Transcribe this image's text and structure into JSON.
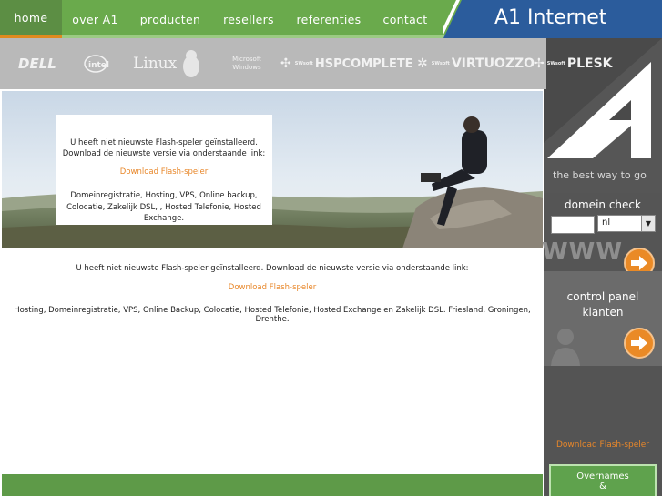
{
  "nav": {
    "items": [
      {
        "label": "home",
        "active": true
      },
      {
        "label": "over A1",
        "active": false
      },
      {
        "label": "producten",
        "active": false
      },
      {
        "label": "resellers",
        "active": false
      },
      {
        "label": "referenties",
        "active": false
      },
      {
        "label": "contact",
        "active": false
      }
    ]
  },
  "brand": {
    "title": "A1 Internet",
    "tagline": "the best way to go"
  },
  "partners": {
    "logos": [
      "DELL",
      "intel",
      "Linux",
      "Microsoft Windows",
      "HSPCOMPLETE",
      "VIRTUOZZO",
      "PLESK"
    ],
    "prefix": "SWsoft"
  },
  "hero": {
    "flash_notice": "U heeft niet nieuwste Flash-speler geïnstalleerd. Download de nieuwste versie via onderstaande link:",
    "flash_link": "Download Flash-speler",
    "services": "Domeinregistratie, Hosting, VPS, Online backup, Colocatie, Zakelijk DSL, , Hosted Telefonie, Hosted Exchange."
  },
  "main": {
    "flash_notice": "U heeft niet nieuwste Flash-speler geïnstalleerd. Download de nieuwste versie via onderstaande link:",
    "flash_link": "Download Flash-speler",
    "services": "Hosting, Domeinregistratie, VPS, Online Backup, Colocatie, Hosted Telefonie, Hosted Exchange en Zakelijk DSL. Friesland, Groningen, Drenthe."
  },
  "sidebar": {
    "domain_title": "domein check",
    "domain_input_value": "",
    "tld_selected": "nl",
    "www_label": "WWW",
    "control_panel_line1": "control panel",
    "control_panel_line2": "klanten",
    "flash_link": "Download Flash-speler",
    "overnames_line1": "Overnames",
    "overnames_line2": "&"
  },
  "colors": {
    "nav_green": "#6aaa4c",
    "accent_orange": "#e8872a",
    "sidebar_gray": "#545454"
  }
}
